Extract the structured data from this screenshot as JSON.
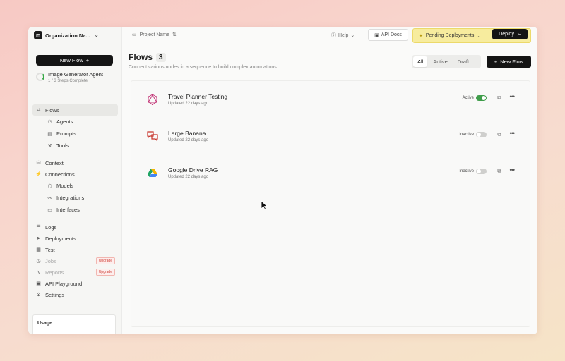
{
  "org": {
    "logo_glyph": "◫",
    "name": "Organization Na...",
    "chevron": "⌄"
  },
  "sidebar": {
    "new_flow_label": "New Flow",
    "new_flow_icon": "+",
    "agent": {
      "name": "Image Generator Agent",
      "steps": "1 / 3 Steps Complete",
      "progress": 0.33
    },
    "items": [
      {
        "label": "Flows",
        "icon": "flow-icon",
        "glyph": "⇄",
        "active": true
      },
      {
        "label": "Agents",
        "icon": "robot-icon",
        "glyph": "⚇",
        "sub": true
      },
      {
        "label": "Prompts",
        "icon": "document-icon",
        "glyph": "▤",
        "sub": true
      },
      {
        "label": "Tools",
        "icon": "wrench-icon",
        "glyph": "⚒",
        "sub": true
      },
      {
        "label": "Context",
        "icon": "database-icon",
        "glyph": "⛁"
      },
      {
        "label": "Connections",
        "icon": "plug-icon",
        "glyph": "⚡"
      },
      {
        "label": "Models",
        "icon": "cube-icon",
        "glyph": "⬡",
        "sub": true
      },
      {
        "label": "Integrations",
        "icon": "link-icon",
        "glyph": "⚯",
        "sub": true
      },
      {
        "label": "Interfaces",
        "icon": "window-icon",
        "glyph": "▭",
        "sub": true
      },
      {
        "label": "Logs",
        "icon": "list-icon",
        "glyph": "☰"
      },
      {
        "label": "Deployments",
        "icon": "send-icon",
        "glyph": "➤"
      },
      {
        "label": "Test",
        "icon": "table-icon",
        "glyph": "▦"
      },
      {
        "label": "Jobs",
        "icon": "clock-icon",
        "glyph": "◷",
        "disabled": true,
        "badge": "Upgrade"
      },
      {
        "label": "Reports",
        "icon": "activity-icon",
        "glyph": "∿",
        "disabled": true,
        "badge": "Upgrade"
      },
      {
        "label": "API Playground",
        "icon": "terminal-icon",
        "glyph": "▣"
      },
      {
        "label": "Settings",
        "icon": "gear-icon",
        "glyph": "⚙"
      }
    ],
    "usage_label": "Usage"
  },
  "topbar": {
    "project_placeholder": "Project Name",
    "help_label": "Help",
    "api_docs_label": "API Docs",
    "pending_label": "Pending Deployments",
    "deploy_label": "Deploy"
  },
  "main": {
    "title": "Flows",
    "count": "3",
    "subtitle": "Connect various nodes in a sequence to build complex automations",
    "filters": [
      "All",
      "Active",
      "Draft"
    ],
    "selected_filter": "All",
    "new_flow_label": "New Flow",
    "flows": [
      {
        "name": "Travel Planner Testing",
        "updated": "Updated 22 days ago",
        "status": "Active",
        "enabled": true,
        "icon": "graphql-icon"
      },
      {
        "name": "Large Banana",
        "updated": "Updated 22 days ago",
        "status": "Inactive",
        "enabled": false,
        "icon": "chat-bubbles-icon"
      },
      {
        "name": "Google Drive RAG",
        "updated": "Updated 22 days ago",
        "status": "Inactive",
        "enabled": false,
        "icon": "google-drive-icon"
      }
    ]
  },
  "colors": {
    "accent": "#141414",
    "active_toggle": "#3f9d4a",
    "pending_bg": "#f7ec9e",
    "upgrade": "#d0433a"
  }
}
